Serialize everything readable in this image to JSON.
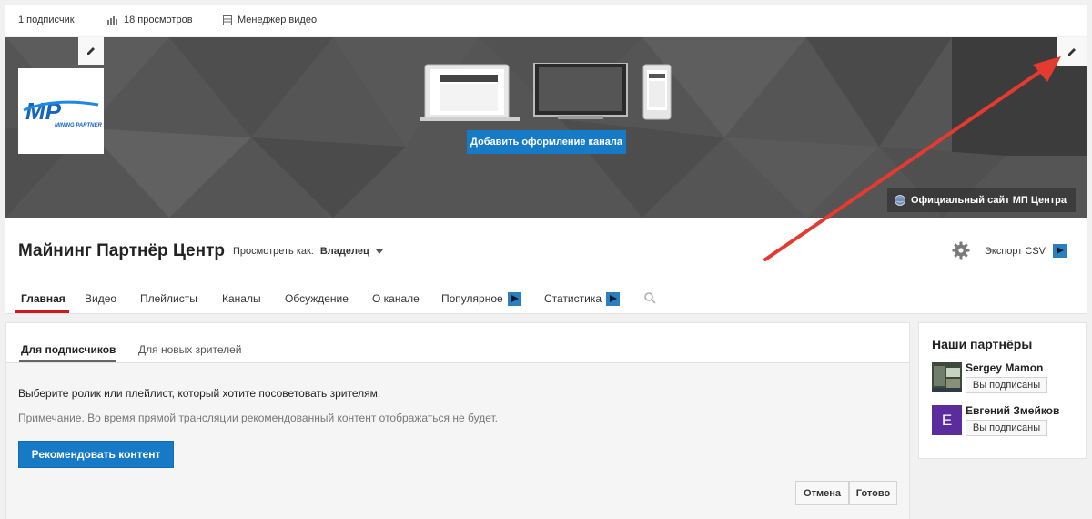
{
  "stats": {
    "subscribers": "1 подписчик",
    "views": "18 просмотров",
    "video_manager": "Менеджер видео"
  },
  "banner": {
    "add_art_button": "Добавить оформление канала",
    "site_link": "Официальный сайт МП Центра",
    "logo": {
      "brand": "MP",
      "subtitle": "MINING PARTNER"
    }
  },
  "channel": {
    "title": "Майнинг Партнёр Центр",
    "view_as_label": "Просмотреть как:",
    "view_as_value": "Владелец",
    "export_label": "Экспорт CSV"
  },
  "nav": {
    "tabs": [
      {
        "label": "Главная",
        "active": true
      },
      {
        "label": "Видео"
      },
      {
        "label": "Плейлисты"
      },
      {
        "label": "Каналы"
      },
      {
        "label": "Обсуждение"
      },
      {
        "label": "О канале"
      },
      {
        "label": "Популярное"
      },
      {
        "label": "Статистика"
      }
    ]
  },
  "main": {
    "subtabs": [
      "Для подписчиков",
      "Для новых зрителей"
    ],
    "instruction": "Выберите ролик или плейлист, который хотите посоветовать зрителям.",
    "note": "Примечание. Во время прямой трансляции рекомендованный контент отображаться не будет.",
    "recommend_button": "Рекомендовать контент",
    "cancel_button": "Отмена",
    "done_button": "Готово"
  },
  "sidebar": {
    "title": "Наши партнёры",
    "partners": [
      {
        "name": "Sergey Mamon",
        "button": "Вы подписаны"
      },
      {
        "name": "Евгений Змейков",
        "button": "Вы подписаны",
        "initial": "E"
      }
    ]
  },
  "colors": {
    "accent_blue": "#167ac6",
    "active_tab_red": "#cc181e",
    "banner_gray": "#555555",
    "avatar_purple": "#5b2d9c",
    "arrow_red": "#e53a2f"
  }
}
